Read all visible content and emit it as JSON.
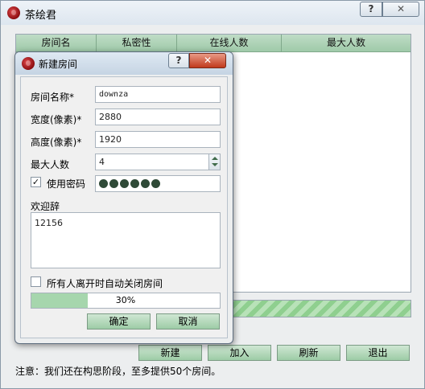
{
  "main": {
    "title": "茶绘君",
    "help_glyph": "?",
    "close_glyph": "✕",
    "table": {
      "columns": [
        "房间名",
        "私密性",
        "在线人数",
        "最大人数"
      ]
    },
    "buttons": {
      "new": "新建",
      "join": "加入",
      "refresh": "刷新",
      "exit": "退出"
    },
    "note": "注意：我们还在构思阶段，至多提供50个房间。",
    "progress_fraction": 1.0
  },
  "dialog": {
    "title": "新建房间",
    "help_glyph": "?",
    "close_glyph": "✕",
    "room_name_label": "房间名称*",
    "room_name_value": "downza",
    "width_label": "宽度(像素)*",
    "width_value": "2880",
    "height_label": "高度(像素)*",
    "height_value": "1920",
    "max_users_label": "最大人数",
    "max_users_value": "4",
    "use_password_label": "使用密码",
    "use_password_checked": "✓",
    "password_length": 6,
    "welcome_label": "欢迎辞",
    "welcome_value": "12156",
    "auto_close_label": "所有人离开时自动关闭房间",
    "progress_percent": 30,
    "progress_text": "30%",
    "ok": "确定",
    "cancel": "取消"
  },
  "colors": {
    "header_green": "#a9d0b2",
    "button_green": "#b6dcbc",
    "progress_green": "#a6d6ad",
    "close_red": "#c0391c"
  },
  "icons": [
    "app-icon",
    "help-icon",
    "close-icon",
    "checkmark-icon",
    "spinner-up-icon",
    "spinner-down-icon"
  ]
}
